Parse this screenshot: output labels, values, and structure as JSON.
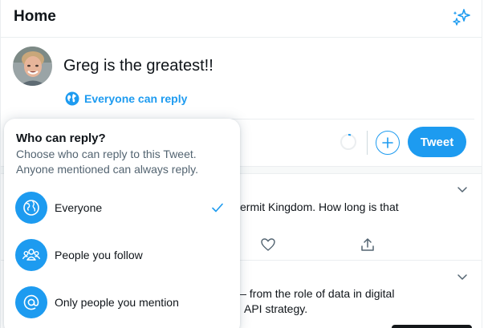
{
  "header": {
    "title": "Home"
  },
  "composer": {
    "text": "Greg is the greatest!!",
    "reply_setting_label": "Everyone can reply",
    "tweet_button_label": "Tweet"
  },
  "feed": [
    {
      "text": "ermit Kingdom. How long is that"
    },
    {
      "text_line1": "— from the role of data in digital",
      "text_line2": "API strategy."
    }
  ],
  "reply_popup": {
    "title": "Who can reply?",
    "description": "Choose who can reply to this Tweet. Anyone mentioned can always reply.",
    "options": [
      {
        "label": "Everyone",
        "icon": "globe-icon",
        "selected": true
      },
      {
        "label": "People you follow",
        "icon": "people-icon",
        "selected": false
      },
      {
        "label": "Only people you mention",
        "icon": "at-icon",
        "selected": false
      }
    ]
  },
  "colors": {
    "accent": "#1d9bf0",
    "text": "#0f1419",
    "muted": "#536471",
    "border": "#ebeef0"
  }
}
